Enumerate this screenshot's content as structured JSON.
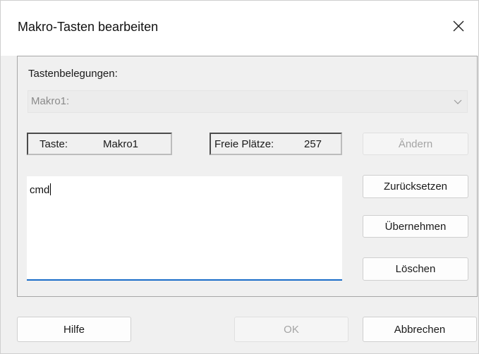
{
  "window": {
    "title": "Makro-Tasten bearbeiten"
  },
  "group": {
    "label": "Tastenbelegungen:",
    "combo": {
      "value": "Makro1:",
      "disabled": true,
      "icon": "chevron-down-icon"
    },
    "taste": {
      "label": "Taste:",
      "value": "Makro1"
    },
    "free_slots": {
      "label": "Freie Plätze:",
      "value": "257"
    },
    "editor": {
      "text": "cmd"
    },
    "buttons": {
      "aendern": "Ändern",
      "zuruecksetzen": "Zurücksetzen",
      "uebernehmen": "Übernehmen",
      "loeschen": "Löschen"
    }
  },
  "footer": {
    "hilfe": "Hilfe",
    "ok": "OK",
    "abbrechen": "Abbrechen"
  },
  "colors": {
    "accent": "#1a6dc8",
    "background": "#f0f0f0",
    "disabled_text": "#a4a4a4"
  }
}
